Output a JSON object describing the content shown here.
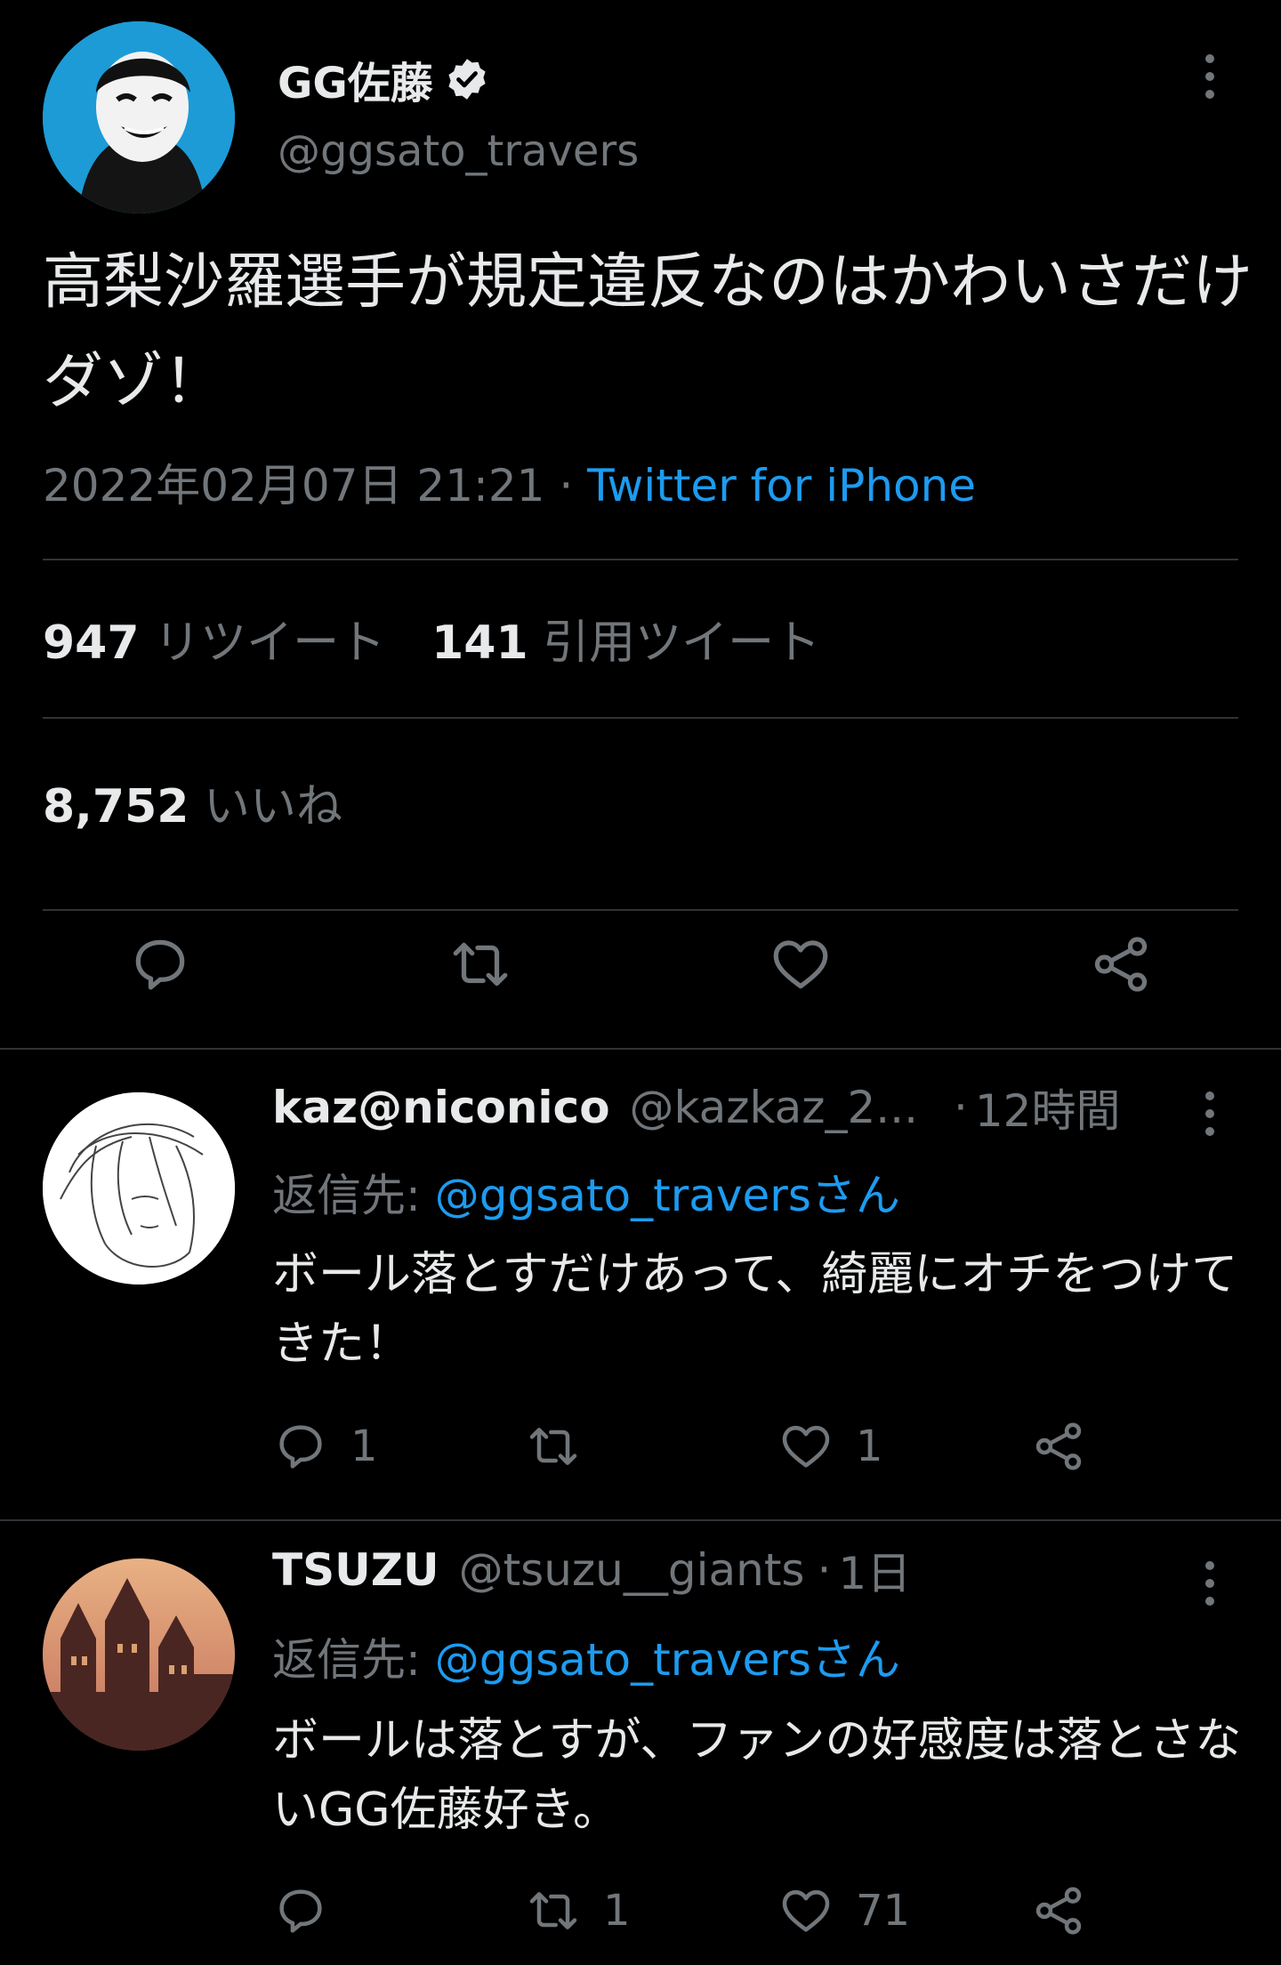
{
  "main_tweet": {
    "display_name": "GG佐藤",
    "handle": "@ggsato_travers",
    "text": "高梨沙羅選手が規定違反なのはかわいさだけダゾ！",
    "date": "2022年02月07日 21:21",
    "separator": " · ",
    "client": "Twitter for iPhone",
    "retweet_count": "947",
    "retweet_label": "リツイート",
    "quote_count": "141",
    "quote_label": "引用ツイート",
    "like_count": "8,752",
    "like_label": "いいね"
  },
  "replies": [
    {
      "display_name": "kaz@niconico",
      "handle": "@kazkaz_2...",
      "dot": "·",
      "time": "12時間",
      "reply_prefix": "返信先: ",
      "reply_to": "@ggsato_traversさん",
      "text": "ボール落とすだけあって、綺麗にオチをつけてきた！",
      "reply_count": "1",
      "retweet_count": "",
      "like_count": "1"
    },
    {
      "display_name": "TSUZU",
      "handle": "@tsuzu__giants",
      "dot": "·",
      "time": "1日",
      "reply_prefix": "返信先: ",
      "reply_to": "@ggsato_traversさん",
      "text": "ボールは落とすが、ファンの好感度は落とさないGG佐藤好き。",
      "reply_count": "",
      "retweet_count": "1",
      "like_count": "71"
    }
  ],
  "icons": {
    "verified": "verified-badge-icon",
    "more": "more-vertical-icon",
    "reply": "reply-bubble-icon",
    "retweet": "retweet-icon",
    "like": "heart-icon",
    "share": "share-icon"
  },
  "colors": {
    "background": "#000000",
    "text": "#e7e9ea",
    "secondary": "#71767b",
    "accent": "#1d9bf0",
    "divider": "#2f3336"
  }
}
